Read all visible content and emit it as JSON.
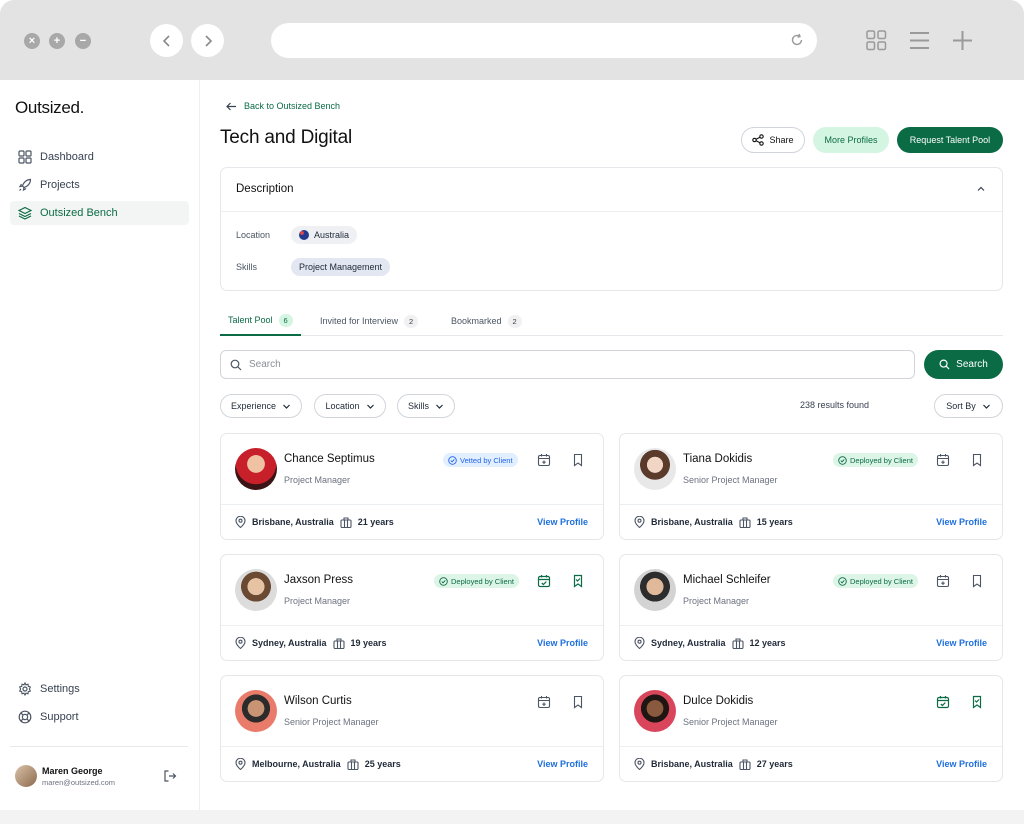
{
  "sidebar": {
    "logo": "Outsized.",
    "nav": [
      {
        "label": "Dashboard",
        "icon": "grid-icon"
      },
      {
        "label": "Projects",
        "icon": "rocket-icon"
      },
      {
        "label": "Outsized Bench",
        "icon": "layers-icon",
        "active": true
      }
    ],
    "bottom_nav": [
      {
        "label": "Settings",
        "icon": "gear-icon"
      },
      {
        "label": "Support",
        "icon": "lifebuoy-icon"
      }
    ],
    "user": {
      "name": "Maren George",
      "email": "maren@outsized.com"
    }
  },
  "header": {
    "back_label": "Back to Outsized Bench",
    "title": "Tech and Digital",
    "share_label": "Share",
    "more_label": "More Profiles",
    "request_label": "Request Talent Pool"
  },
  "description": {
    "title": "Description",
    "location_label": "Location",
    "location_value": "Australia",
    "skills_label": "Skills",
    "skill_value": "Project Management"
  },
  "tabs": [
    {
      "label": "Talent Pool",
      "count": "6",
      "active": true
    },
    {
      "label": "Invited for Interview",
      "count": "2"
    },
    {
      "label": "Bookmarked",
      "count": "2"
    }
  ],
  "search": {
    "placeholder": "Search",
    "button_label": "Search"
  },
  "filters": {
    "experience": "Experience",
    "location": "Location",
    "skills": "Skills",
    "results": "238 results found",
    "sort": "Sort By"
  },
  "colors": {
    "brand": "#0b6b45",
    "brand_light": "#d4f5e2",
    "link": "#1d6fdc"
  },
  "profiles": [
    {
      "name": "Chance Septimus",
      "role": "Project Manager",
      "badge": "Vetted by Client",
      "badge_type": "vetted",
      "location": "Brisbane, Australia",
      "experience": "21 years",
      "link": "View Profile",
      "scheduled": false,
      "bookmarked": false
    },
    {
      "name": "Tiana Dokidis",
      "role": "Senior Project Manager",
      "badge": "Deployed by Client",
      "badge_type": "deployed",
      "location": "Brisbane, Australia",
      "experience": "15 years",
      "link": "View Profile",
      "scheduled": false,
      "bookmarked": false
    },
    {
      "name": "Jaxson Press",
      "role": "Project Manager",
      "badge": "Deployed by Client",
      "badge_type": "deployed",
      "location": "Sydney, Australia",
      "experience": "19 years",
      "link": "View Profile",
      "scheduled": true,
      "bookmarked": true
    },
    {
      "name": "Michael Schleifer",
      "role": "Project Manager",
      "badge": "Deployed by Client",
      "badge_type": "deployed",
      "location": "Sydney, Australia",
      "experience": "12 years",
      "link": "View Profile",
      "scheduled": false,
      "bookmarked": false
    },
    {
      "name": "Wilson Curtis",
      "role": "Senior Project Manager",
      "badge": "",
      "badge_type": "",
      "location": "Melbourne, Australia",
      "experience": "25 years",
      "link": "View Profile",
      "scheduled": false,
      "bookmarked": false
    },
    {
      "name": "Dulce Dokidis",
      "role": "Senior Project Manager",
      "badge": "",
      "badge_type": "",
      "location": "Brisbane, Australia",
      "experience": "27 years",
      "link": "View Profile",
      "scheduled": true,
      "bookmarked": true
    }
  ]
}
